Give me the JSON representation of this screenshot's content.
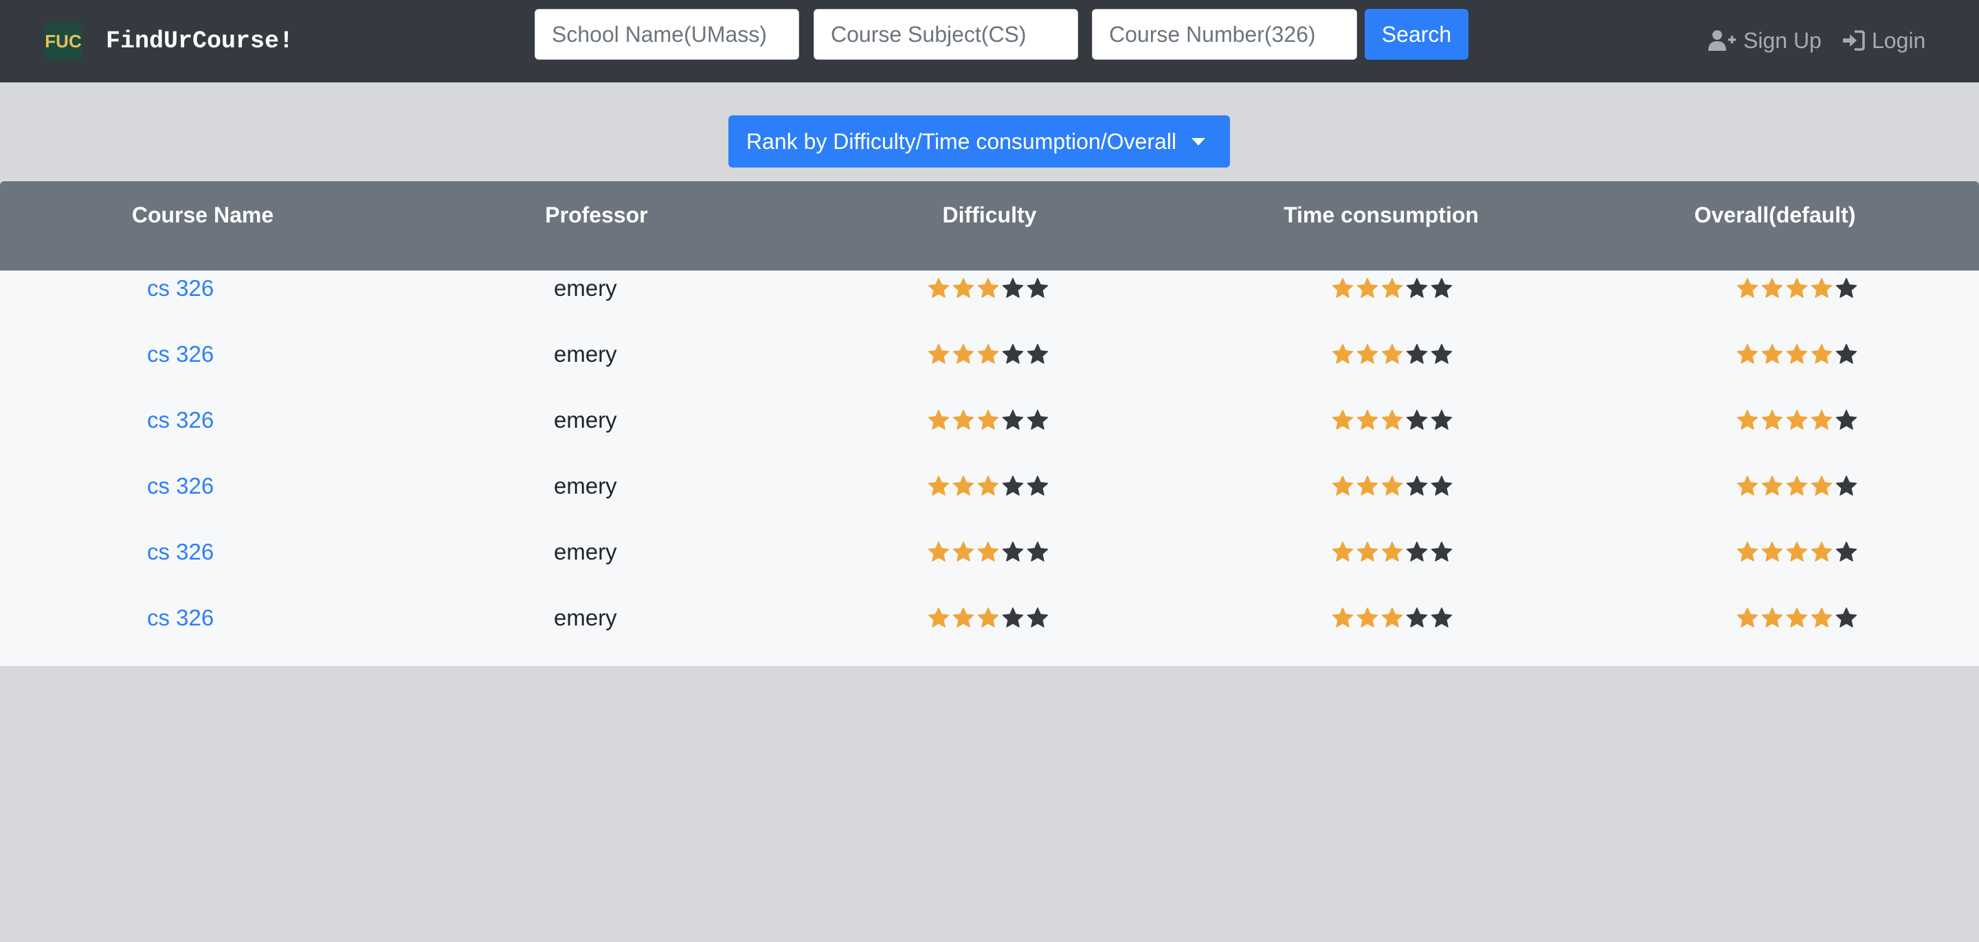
{
  "navbar": {
    "logo_text": "FUC",
    "brand": "FindUrCourse!",
    "school_placeholder": "School Name(UMass)",
    "subject_placeholder": "Course Subject(CS)",
    "number_placeholder": "Course Number(326)",
    "search_label": "Search",
    "signup_label": "Sign Up",
    "login_label": "Login"
  },
  "rank_dropdown": {
    "label": "Rank by Difficulty/Time consumption/Overall"
  },
  "table": {
    "headers": [
      "Course Name",
      "Professor",
      "Difficulty",
      "Time consumption",
      "Overall(default)"
    ],
    "max_stars": 5,
    "rows": [
      {
        "course": "cs 326",
        "professor": "emery",
        "difficulty": 3,
        "time": 3,
        "overall": 4
      },
      {
        "course": "cs 326",
        "professor": "emery",
        "difficulty": 3,
        "time": 3,
        "overall": 4
      },
      {
        "course": "cs 326",
        "professor": "emery",
        "difficulty": 3,
        "time": 3,
        "overall": 4
      },
      {
        "course": "cs 326",
        "professor": "emery",
        "difficulty": 3,
        "time": 3,
        "overall": 4
      },
      {
        "course": "cs 326",
        "professor": "emery",
        "difficulty": 3,
        "time": 3,
        "overall": 4
      },
      {
        "course": "cs 326",
        "professor": "emery",
        "difficulty": 3,
        "time": 3,
        "overall": 4
      }
    ]
  },
  "colors": {
    "navbar_bg": "#343a40",
    "primary": "#2d7ff9",
    "star_filled": "#f0a53a",
    "star_empty": "#343a40",
    "table_head_bg": "#6c757d"
  }
}
